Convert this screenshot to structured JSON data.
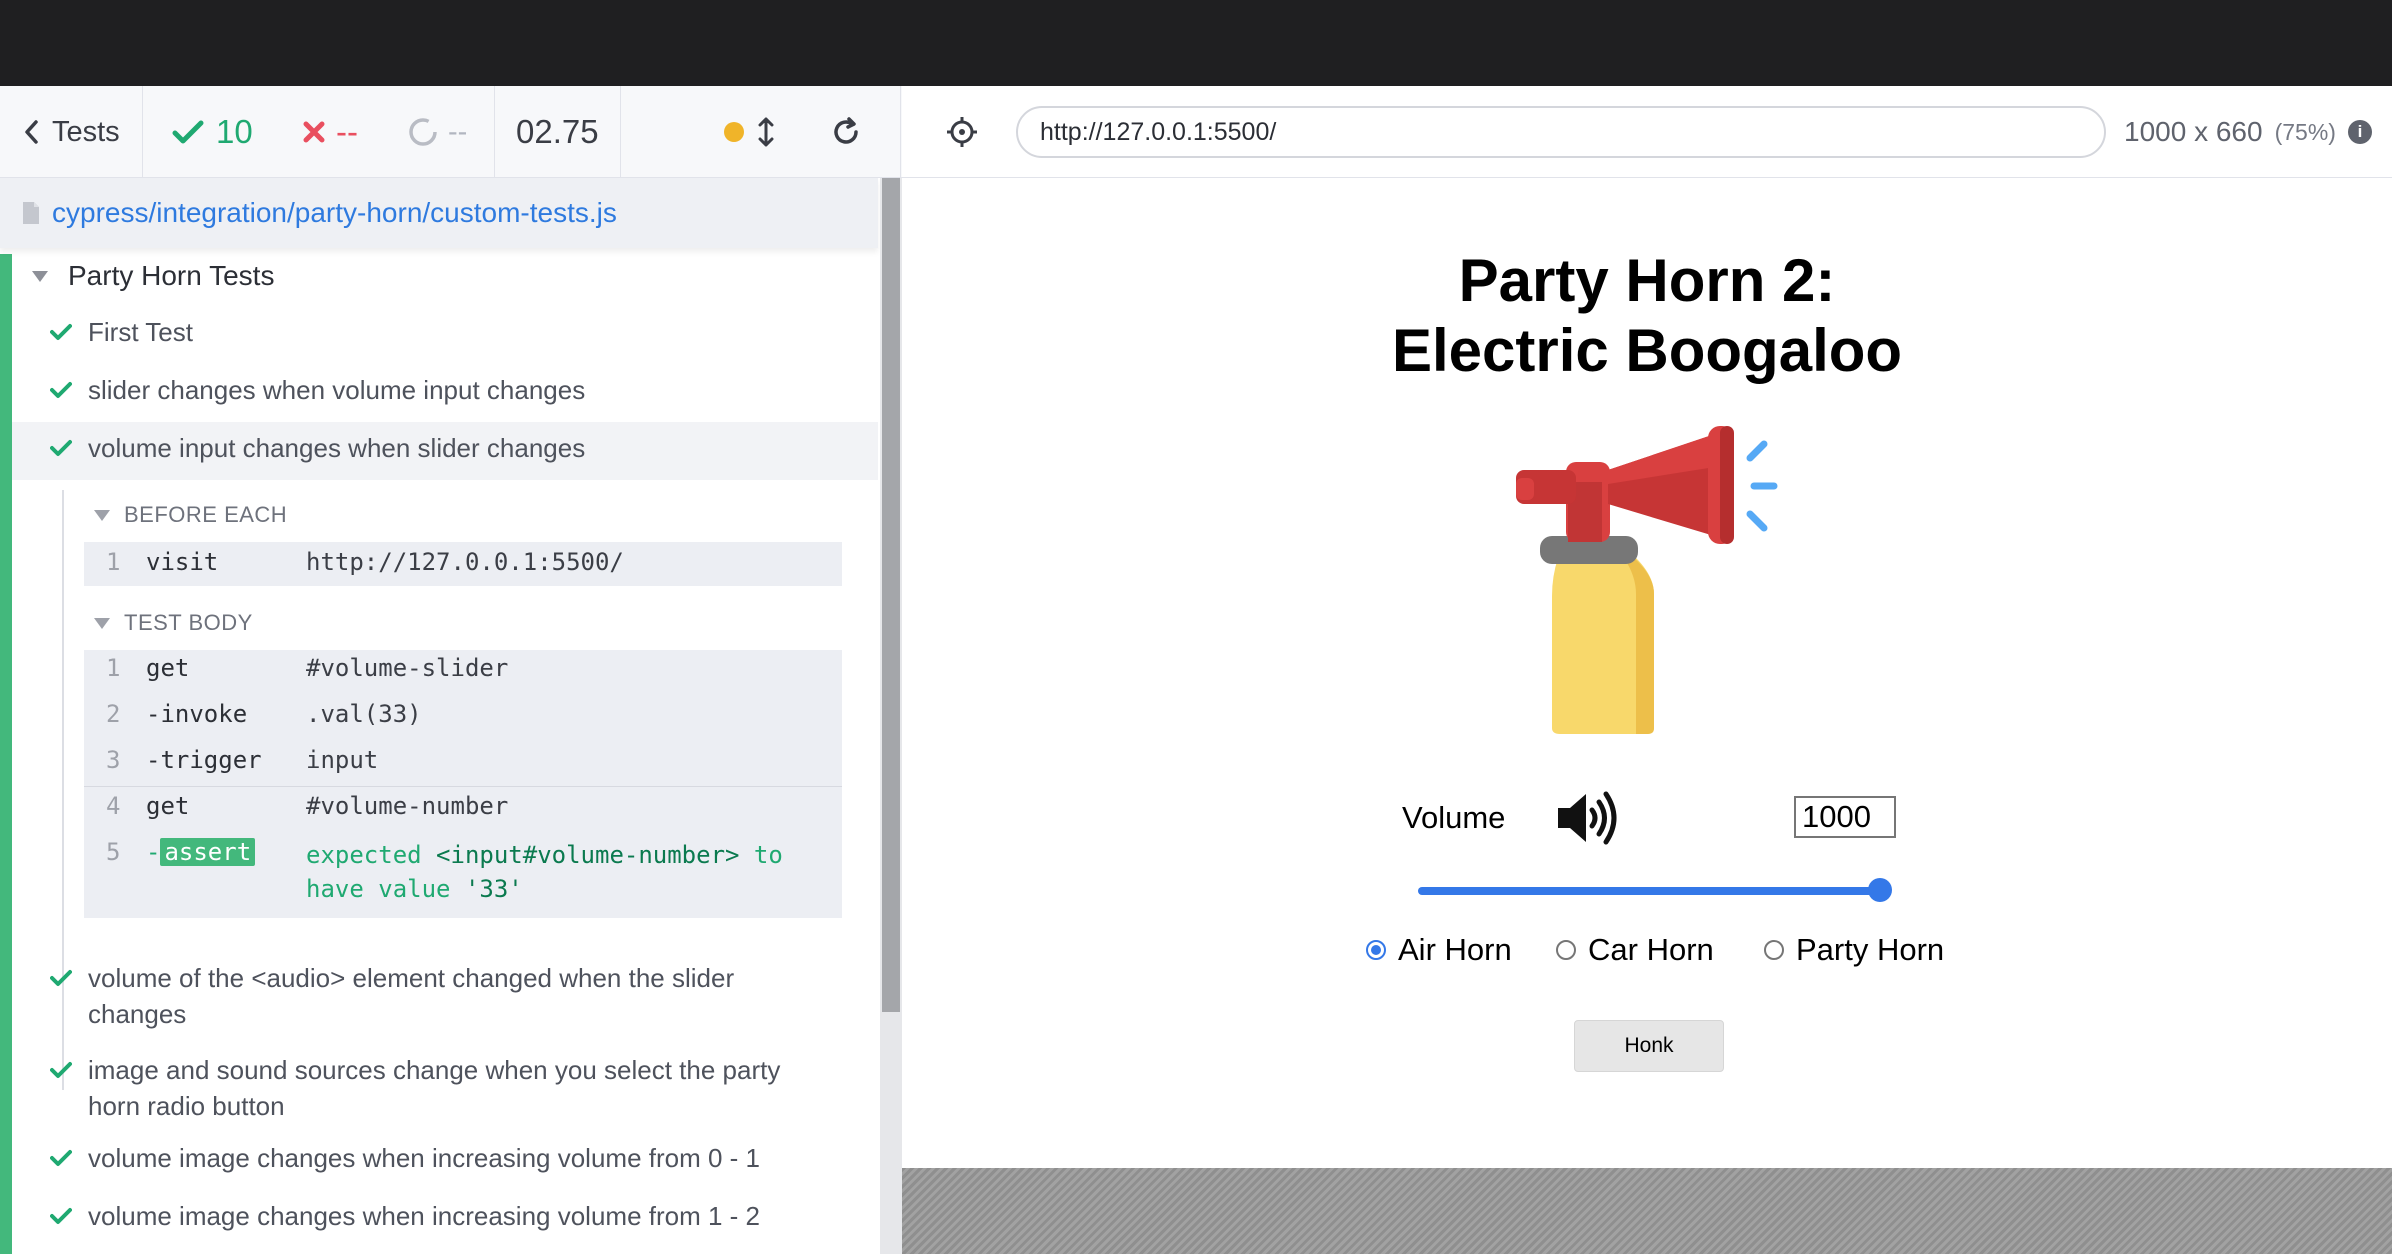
{
  "reporter": {
    "tests_label": "Tests",
    "passed": "10",
    "failed": "--",
    "pending": "--",
    "duration": "02.75",
    "spec_path": "cypress/integration/party-horn/custom-tests.js",
    "suite_title": "Party Horn Tests",
    "tests": [
      {
        "title": "First Test",
        "state": "passed"
      },
      {
        "title": "slider changes when volume input changes",
        "state": "passed"
      },
      {
        "title": "volume input changes when slider changes",
        "state": "passed"
      },
      {
        "title": "volume of the <audio> element changed when the slider changes",
        "state": "passed"
      },
      {
        "title": "image and sound sources change when you select the party horn radio button",
        "state": "passed"
      },
      {
        "title": "volume image changes when increasing volume from 0 - 1",
        "state": "passed"
      },
      {
        "title": "volume image changes when increasing volume from 1 - 2",
        "state": "passed"
      }
    ],
    "hooks": {
      "before_each": {
        "title": "BEFORE EACH",
        "commands": [
          {
            "num": "1",
            "name": "visit",
            "message": "http://127.0.0.1:5500/"
          }
        ]
      },
      "test_body": {
        "title": "TEST BODY",
        "commands": [
          {
            "num": "1",
            "name": "get",
            "message": "#volume-slider"
          },
          {
            "num": "2",
            "name": "-invoke",
            "message": ".val(33)"
          },
          {
            "num": "3",
            "name": "-trigger",
            "message": "input"
          },
          {
            "num": "4",
            "name": "get",
            "message": "#volume-number"
          },
          {
            "num": "5",
            "name_prefix": "-",
            "name": "assert",
            "message_line1_a": "expected ",
            "message_line1_b": "<input#volume-number>",
            "message_line1_c": " to",
            "message_line2_a": "have value ",
            "message_line2_b": "'33'"
          }
        ]
      }
    }
  },
  "aut_header": {
    "url": "http://127.0.0.1:5500/",
    "viewport_size": "1000 x 660",
    "viewport_scale": "(75%)",
    "info_glyph": "i"
  },
  "aut": {
    "title_line1": "Party Horn 2:",
    "title_line2": "Electric Boogaloo",
    "volume_label": "Volume",
    "volume_value": "1000",
    "volume_slider_fraction": 1.0,
    "horn_options": [
      {
        "label": "Air Horn",
        "checked": true
      },
      {
        "label": "Car Horn",
        "checked": false
      },
      {
        "label": "Party Horn",
        "checked": false
      }
    ],
    "honk_label": "Honk"
  },
  "colors": {
    "passed": "#1fa971",
    "failed": "#e94f5f",
    "link": "#2e7adf",
    "accent": "#3478e8",
    "running_dot": "#f0b429"
  },
  "icons": [
    "chevron-left-icon",
    "check-icon",
    "x-icon",
    "spinner-icon",
    "running-dot-icon",
    "resize-icon",
    "reload-icon",
    "crosshair-icon",
    "info-icon",
    "file-icon",
    "triangle-down-icon",
    "air-horn-image",
    "volume-high-icon"
  ]
}
